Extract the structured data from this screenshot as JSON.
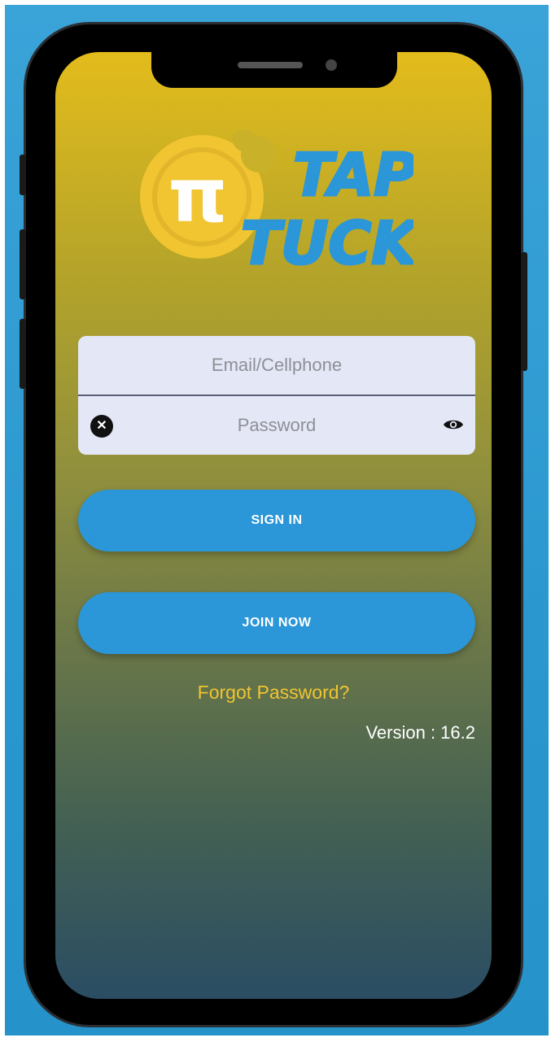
{
  "app": {
    "logo_text_line1": "TAP",
    "logo_text_line2": "TUCK",
    "logo_symbol": "π"
  },
  "login": {
    "email_placeholder": "Email/Cellphone",
    "password_placeholder": "Password",
    "clear_icon": "x-circle-icon",
    "visibility_icon": "eye-icon"
  },
  "actions": {
    "sign_in_label": "SIGN IN",
    "join_now_label": "JOIN NOW",
    "forgot_password_label": "Forgot Password?"
  },
  "footer": {
    "version_text": "Version : 16.2"
  },
  "colors": {
    "accent_blue": "#2b96d8",
    "logo_yellow": "#f0c531",
    "forgot_link": "#f0c531",
    "input_bg": "#e4e7f6"
  }
}
